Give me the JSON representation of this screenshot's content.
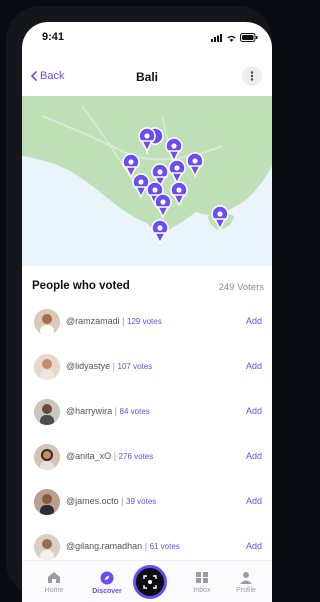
{
  "status": {
    "time": "9:41"
  },
  "navbar": {
    "back_label": "Back",
    "title": "Bali"
  },
  "voters": {
    "heading": "People who voted",
    "count": "249 Voters",
    "rows": [
      {
        "handle": "@ramzamadi",
        "votes": "129 votes",
        "action": "Add"
      },
      {
        "handle": "@lidyastye",
        "votes": "107 votes",
        "action": "Add"
      },
      {
        "handle": "@harrywira",
        "votes": "84 votes",
        "action": "Add"
      },
      {
        "handle": "@anita_xO",
        "votes": "276 votes",
        "action": "Add"
      },
      {
        "handle": "@james.octo",
        "votes": "39 votes",
        "action": "Add"
      },
      {
        "handle": "@gilang.ramadhan",
        "votes": "61 votes",
        "action": "Add"
      }
    ]
  },
  "tabbar": {
    "items": [
      {
        "label": "Home",
        "icon": "home-icon"
      },
      {
        "label": "Discover",
        "icon": "compass-icon",
        "active": true
      },
      {
        "label": "",
        "icon": "scan-icon"
      },
      {
        "label": "Inbox",
        "icon": "inbox-icon"
      },
      {
        "label": "Profile",
        "icon": "profile-icon"
      }
    ]
  },
  "colors": {
    "accent": "#6b4cf5",
    "map_land": "#bfe0b6",
    "map_water": "#eaf4fb"
  }
}
